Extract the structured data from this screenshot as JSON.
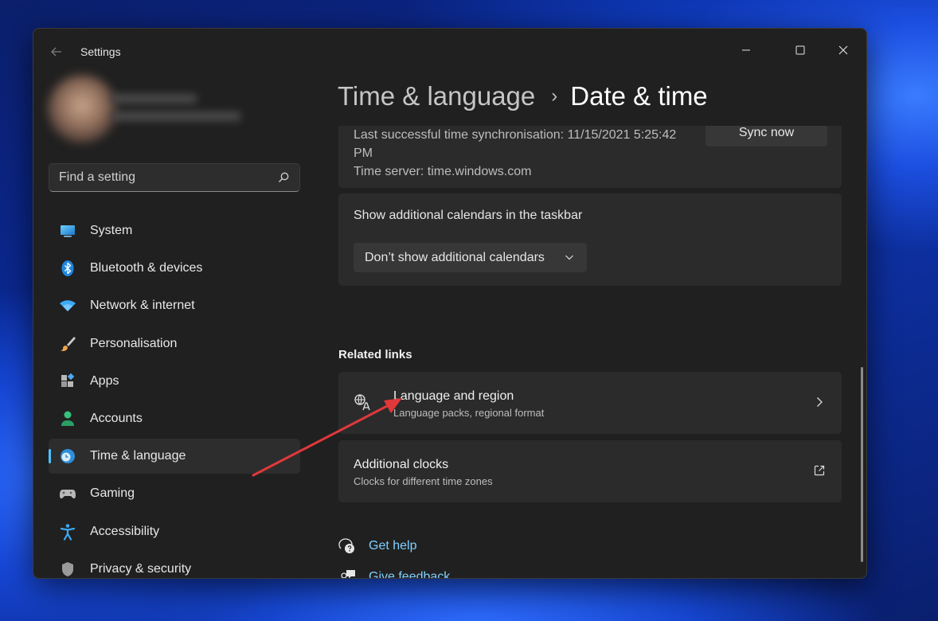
{
  "window": {
    "title": "Settings",
    "back_icon": "arrow-left-icon",
    "controls": [
      "minimize-icon",
      "maximize-icon",
      "close-icon"
    ]
  },
  "search": {
    "placeholder": "Find a setting",
    "icon": "search-icon"
  },
  "sidebar": {
    "items": [
      {
        "label": "System",
        "icon": "monitor-icon",
        "selected": false
      },
      {
        "label": "Bluetooth & devices",
        "icon": "bluetooth-icon",
        "selected": false
      },
      {
        "label": "Network & internet",
        "icon": "wifi-icon",
        "selected": false
      },
      {
        "label": "Personalisation",
        "icon": "paintbrush-icon",
        "selected": false
      },
      {
        "label": "Apps",
        "icon": "apps-icon",
        "selected": false
      },
      {
        "label": "Accounts",
        "icon": "person-icon",
        "selected": false
      },
      {
        "label": "Time & language",
        "icon": "globe-clock-icon",
        "selected": true
      },
      {
        "label": "Gaming",
        "icon": "gamepad-icon",
        "selected": false
      },
      {
        "label": "Accessibility",
        "icon": "accessibility-icon",
        "selected": false
      },
      {
        "label": "Privacy & security",
        "icon": "shield-icon",
        "selected": false
      }
    ]
  },
  "header": {
    "parent": "Time & language",
    "separator": "›",
    "current": "Date & time"
  },
  "sync": {
    "last_sync": "Last successful time synchronisation: 11/15/2021 5:25:42 PM",
    "server": "Time server: time.windows.com",
    "button_label": "Sync now"
  },
  "calendars": {
    "label": "Show additional calendars in the taskbar",
    "selected_option": "Don’t show additional calendars"
  },
  "related": {
    "heading": "Related links",
    "links": [
      {
        "title": "Language and region",
        "subtitle": "Language packs, regional format",
        "icon": "language-icon",
        "action_icon": "chevron-right-icon"
      },
      {
        "title": "Additional clocks",
        "subtitle": "Clocks for different time zones",
        "action_icon": "open-external-icon"
      }
    ]
  },
  "help": {
    "get_help": "Get help",
    "give_feedback": "Give feedback"
  },
  "colors": {
    "accent": "#4cc2ff",
    "annotation_arrow": "#e0383b",
    "window_bg": "#202020",
    "card_bg": "#2b2b2b"
  }
}
